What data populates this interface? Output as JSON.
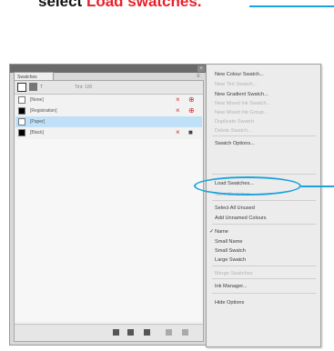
{
  "caption": {
    "prefix": "select ",
    "highlight": "Load swatches."
  },
  "panel": {
    "tab_label": "Swatches",
    "tint_label": "Tint: 100",
    "swatches": [
      {
        "name": "[None]",
        "color": "#ffffff"
      },
      {
        "name": "[Registration]",
        "color": "#000000"
      },
      {
        "name": "[Paper]",
        "color": "#ffffff"
      },
      {
        "name": "[Black]",
        "color": "#000000"
      }
    ]
  },
  "menu": {
    "items": [
      {
        "label": "New Colour Swatch...",
        "disabled": false
      },
      {
        "label": "New Tint Swatch...",
        "disabled": true
      },
      {
        "label": "New Gradient Swatch...",
        "disabled": false
      },
      {
        "label": "New Mixed Ink Swatch...",
        "disabled": true
      },
      {
        "label": "New Mixed Ink Group...",
        "disabled": true
      },
      {
        "label": "Duplicate Swatch",
        "disabled": true
      },
      {
        "label": "Delete Swatch...",
        "disabled": true
      },
      {
        "label": "Swatch Options...",
        "disabled": false
      },
      {
        "label": "Load Swatches...",
        "disabled": false
      },
      {
        "label": "Save Swatches...",
        "disabled": true
      },
      {
        "label": "Select All Unused",
        "disabled": false
      },
      {
        "label": "Add Unnamed Colours",
        "disabled": false
      },
      {
        "label": "Name",
        "disabled": false,
        "checked": true
      },
      {
        "label": "Small Name",
        "disabled": false
      },
      {
        "label": "Small Swatch",
        "disabled": false
      },
      {
        "label": "Large Swatch",
        "disabled": false
      },
      {
        "label": "Merge Swatches",
        "disabled": true
      },
      {
        "label": "Ink Manager...",
        "disabled": false
      },
      {
        "label": "Hide Options",
        "disabled": false
      }
    ]
  },
  "colors": {
    "accent": "#1aa3dd",
    "caption_highlight": "#e8202a",
    "selected_row": "#bfe0f6"
  }
}
